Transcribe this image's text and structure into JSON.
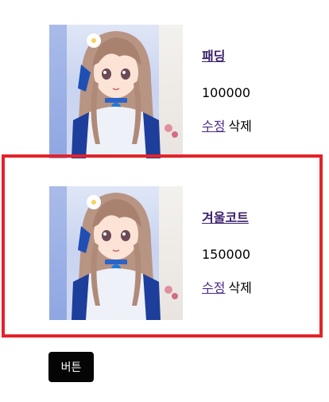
{
  "products": [
    {
      "name": "패딩",
      "price": "100000",
      "edit_label": "수정",
      "delete_label": "삭제",
      "image": "anime-girl-illustration"
    },
    {
      "name": "겨울코트",
      "price": "150000",
      "edit_label": "수정",
      "delete_label": "삭제",
      "image": "anime-girl-illustration"
    }
  ],
  "button": {
    "label": "버튼"
  },
  "colors": {
    "highlight": "#e2232a",
    "link": "#4b2a8a",
    "button_bg": "#050505"
  }
}
